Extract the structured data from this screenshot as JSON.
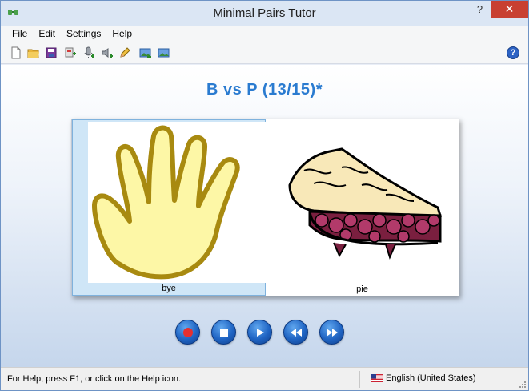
{
  "window": {
    "title": "Minimal Pairs Tutor"
  },
  "menu": {
    "items": [
      "File",
      "Edit",
      "Settings",
      "Help"
    ]
  },
  "toolbar": {
    "buttons": [
      "new-file-icon",
      "open-folder-icon",
      "save-icon",
      "add-item-icon",
      "record-microphone-icon",
      "sound-add-icon",
      "edit-pencil-icon",
      "add-picture-icon",
      "picture-icon"
    ],
    "help_label": "?"
  },
  "main": {
    "heading": "B vs P (13/15)*",
    "cards": [
      {
        "word": "bye",
        "image": "hand-picture",
        "selected": true
      },
      {
        "word": "pie",
        "image": "cherry-pie-picture",
        "selected": false
      }
    ],
    "controls": [
      "record-icon",
      "stop-icon",
      "play-icon",
      "rewind-icon",
      "fast-forward-icon"
    ]
  },
  "status": {
    "help_text": "For Help, press F1, or click on the Help icon.",
    "language": "English (United States)"
  },
  "colors": {
    "accent": "#2a7bd0",
    "close": "#c84031",
    "control": "#1f64c3"
  }
}
